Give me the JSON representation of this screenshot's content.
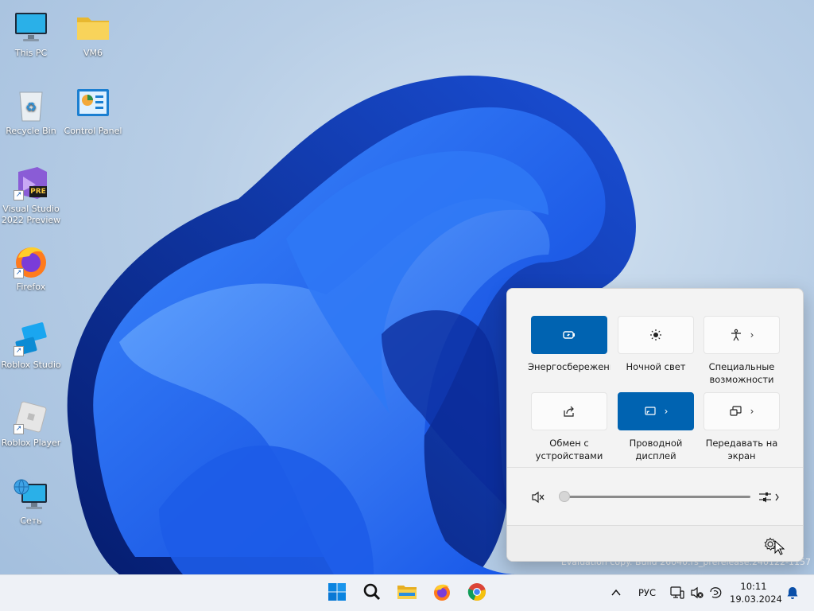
{
  "desktop": {
    "icons": [
      {
        "label": "This PC",
        "icon": "monitor-icon"
      },
      {
        "label": "VM6",
        "icon": "folder-icon"
      },
      {
        "label": "Recycle Bin",
        "icon": "recycle-bin-icon"
      },
      {
        "label": "Control Panel",
        "icon": "control-panel-icon"
      },
      {
        "label": "Visual Studio 2022 Preview",
        "icon": "visual-studio-icon",
        "badge": "PRE"
      },
      {
        "label": "Firefox",
        "icon": "firefox-icon"
      },
      {
        "label": "Roblox Studio",
        "icon": "roblox-studio-icon"
      },
      {
        "label": "Roblox Player",
        "icon": "roblox-player-icon"
      },
      {
        "label": "Сеть",
        "icon": "network-icon"
      }
    ],
    "watermark": "Evaluation copy. Build 26040.rs_prerelease.240122-1157"
  },
  "quick_settings": {
    "tiles": [
      {
        "label": "Энергосбережение",
        "icon": "battery-saver-icon",
        "active": true,
        "has_chevron": false
      },
      {
        "label": "Ночной свет",
        "icon": "night-light-icon",
        "active": false,
        "has_chevron": false
      },
      {
        "label": "Специальные возможности",
        "icon": "accessibility-icon",
        "active": false,
        "has_chevron": true
      },
      {
        "label": "Обмен с устройствами поблизости",
        "icon": "nearby-share-icon",
        "active": false,
        "has_chevron": false
      },
      {
        "label": "Проводной дисплей",
        "icon": "wired-display-icon",
        "active": true,
        "has_chevron": true
      },
      {
        "label": "Передавать на экран",
        "icon": "cast-icon",
        "active": false,
        "has_chevron": true
      }
    ],
    "volume": {
      "level": 0,
      "muted": true,
      "icon": "speaker-muted-icon",
      "mixer_icon": "audio-mixer-icon"
    },
    "footer": {
      "settings_icon": "gear-icon"
    }
  },
  "taskbar": {
    "pinned": [
      {
        "name": "start-button",
        "icon": "windows-logo-icon"
      },
      {
        "name": "search-button",
        "icon": "search-icon"
      },
      {
        "name": "file-explorer-button",
        "icon": "folder-icon"
      },
      {
        "name": "firefox-button",
        "icon": "firefox-icon"
      },
      {
        "name": "chrome-button",
        "icon": "chrome-icon"
      }
    ],
    "tray": {
      "chevron": "^",
      "language": "РУС",
      "time": "10:11",
      "date": "19.03.2024"
    }
  },
  "colors": {
    "accent": "#0063b1",
    "taskbar_bg": "#eef1f6",
    "flyout_bg": "#f3f3f3"
  }
}
